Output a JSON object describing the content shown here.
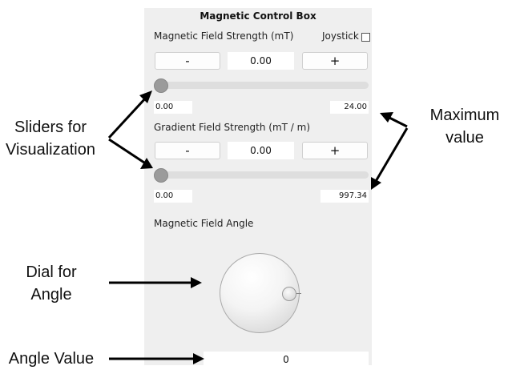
{
  "panel": {
    "title": "Magnetic Control Box",
    "field_strength": {
      "label": "Magnetic Field Strength (mT)",
      "minus_label": "-",
      "value": "0.00",
      "plus_label": "+",
      "slider_fraction": 0.0,
      "min_text": "0.00",
      "max_text": "24.00"
    },
    "joystick_label": "Joystick",
    "joystick_checked": false,
    "gradient_strength": {
      "label": "Gradient Field Strength (mT / m)",
      "minus_label": "-",
      "value": "0.00",
      "plus_label": "+",
      "slider_fraction": 0.0,
      "min_text": "0.00",
      "max_text": "997.34"
    },
    "angle": {
      "label": "Magnetic Field Angle",
      "value": "0"
    }
  },
  "annotations": {
    "sliders": [
      "Sliders for",
      "Visualization"
    ],
    "maximum": [
      "Maximum",
      "value"
    ],
    "dial": [
      "Dial for",
      "Angle"
    ],
    "angle_value": "Angle Value"
  }
}
